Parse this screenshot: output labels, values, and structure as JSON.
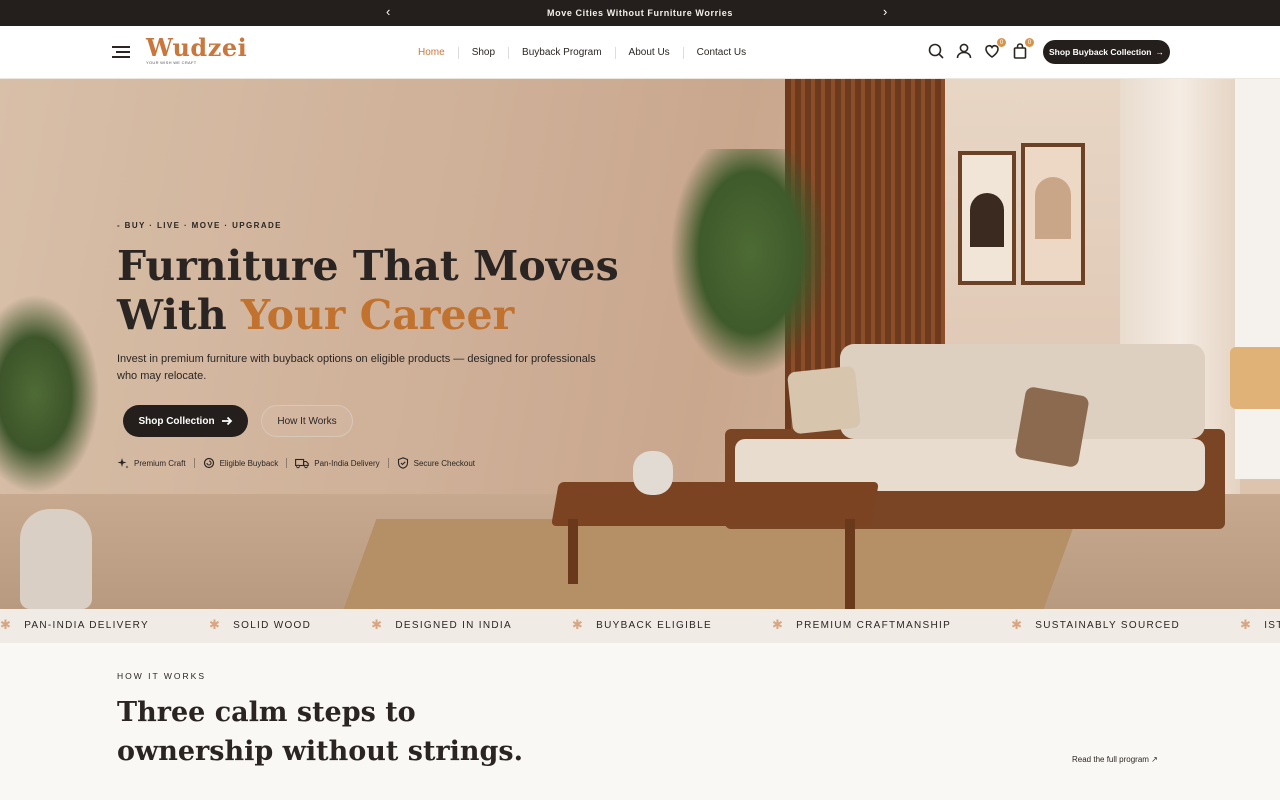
{
  "announcement": {
    "message": "Move Cities Without Furniture Worries",
    "prev_icon": "chevron-left",
    "next_icon": "chevron-right"
  },
  "header": {
    "logo": {
      "wordmark": "Wudzei",
      "tagline": "YOUR WISH WE CRAFT"
    },
    "nav": [
      "Home",
      "Shop",
      "Buyback Program",
      "About Us",
      "Contact Us"
    ],
    "active_nav": "Home",
    "wishlist_count": "0",
    "cart_count": "0",
    "cta_label": "Shop Buyback Collection"
  },
  "hero": {
    "kicker": "- BUY · LIVE · MOVE · UPGRADE",
    "title_line1": "Furniture That Moves",
    "title_line2_plain": "With ",
    "title_line2_accent": "Your Career",
    "subtitle": "Invest in premium furniture with buyback options on eligible products — designed for professionals who may relocate.",
    "primary_button": "Shop Collection",
    "secondary_button": "How It Works",
    "features": [
      {
        "icon": "sparkle-icon",
        "label": "Premium Craft"
      },
      {
        "icon": "refresh-icon",
        "label": "Eligible Buyback"
      },
      {
        "icon": "truck-icon",
        "label": "Pan-India Delivery"
      },
      {
        "icon": "shield-check-icon",
        "label": "Secure Checkout"
      }
    ]
  },
  "marquee": [
    "PAN-INDIA DELIVERY",
    "SOLID WOOD",
    "DESIGNED IN INDIA",
    "BUYBACK ELIGIBLE",
    "PREMIUM CRAFTMANSHIP",
    "SUSTAINABLY SOURCED",
    "ISTART NEST REGISTERED"
  ],
  "how_it_works": {
    "label": "HOW IT WORKS",
    "title": "Three calm steps to ownership without strings.",
    "link": "Read the full program ↗"
  },
  "colors": {
    "accent": "#c1722f",
    "dark": "#241f1c",
    "cream": "#faf8f4"
  }
}
